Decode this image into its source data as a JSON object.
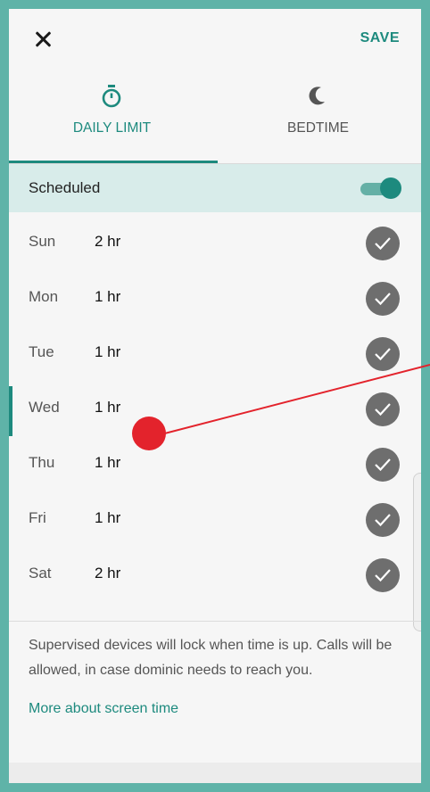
{
  "topbar": {
    "close_icon": "close-icon",
    "save_label": "SAVE"
  },
  "tabs": [
    {
      "label": "DAILY LIMIT",
      "icon": "timer-icon",
      "active": true
    },
    {
      "label": "BEDTIME",
      "icon": "moon-icon",
      "active": false
    }
  ],
  "schedule": {
    "label": "Scheduled",
    "enabled": true
  },
  "days": [
    {
      "day": "Sun",
      "limit": "2 hr",
      "checked": true
    },
    {
      "day": "Mon",
      "limit": "1 hr",
      "checked": true
    },
    {
      "day": "Tue",
      "limit": "1 hr",
      "checked": true
    },
    {
      "day": "Wed",
      "limit": "1 hr",
      "checked": true
    },
    {
      "day": "Thu",
      "limit": "1 hr",
      "checked": true
    },
    {
      "day": "Fri",
      "limit": "1 hr",
      "checked": true
    },
    {
      "day": "Sat",
      "limit": "2 hr",
      "checked": true
    }
  ],
  "info": {
    "text": "Supervised devices will lock when time is up. Calls will be allowed, in case dominic needs to reach you.",
    "link": "More about screen time"
  },
  "colors": {
    "frame": "#5fb3a8",
    "accent": "#1d8a7e",
    "check_bg": "#6e6e6e",
    "annotation": "#e3232c"
  }
}
